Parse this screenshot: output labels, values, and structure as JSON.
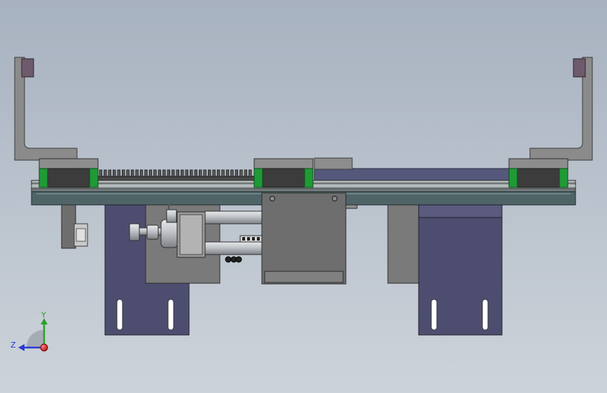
{
  "viewport": {
    "background_top": "#a7b2c0",
    "background_bottom": "#cdd3da"
  },
  "colors": {
    "bracket_grey": "#8b8b8b",
    "rubber_pad": "#6d5a6a",
    "carriage_green": "#1f9a36",
    "carriage_body": "#3c3c3c",
    "rail_body": "#4f6467",
    "base_plate": "#4d4e6f",
    "cylinder_steel": "#c3c6ca",
    "mount_block": "#6e6e6e"
  },
  "rack": {
    "tooth_count": 34
  },
  "triad": {
    "x_axis": {
      "label": "",
      "color": "#d21a1a"
    },
    "y_axis": {
      "label": "Y",
      "color": "#2aa02a"
    },
    "z_axis": {
      "label": "Z",
      "color": "#2a3ad0"
    }
  }
}
